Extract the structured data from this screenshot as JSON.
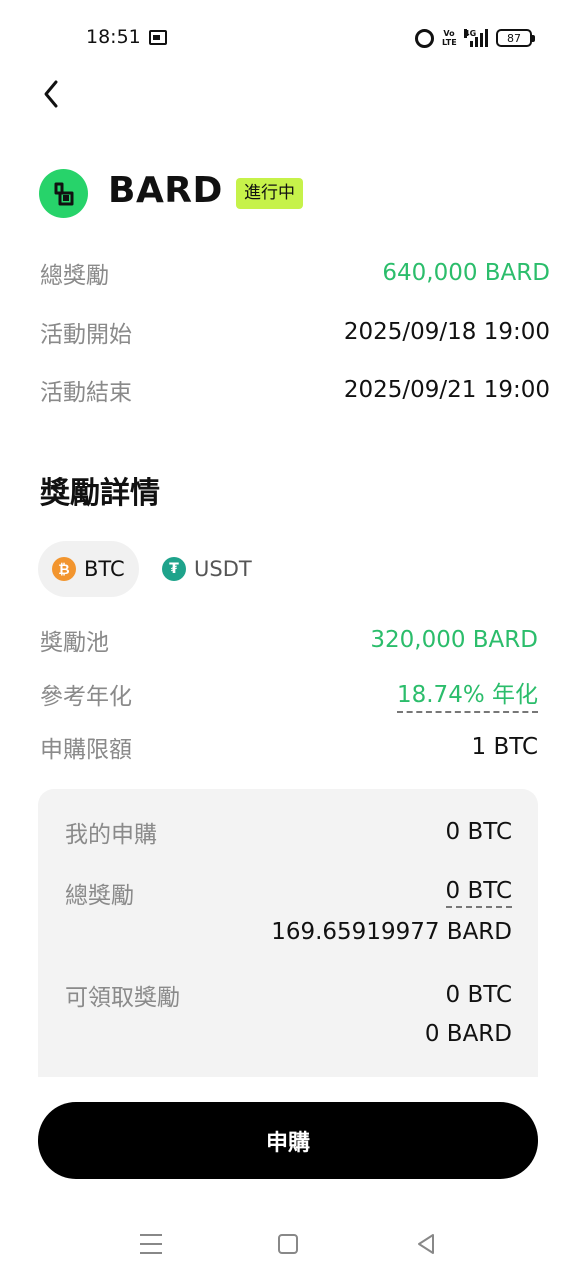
{
  "status_bar": {
    "time": "18:51",
    "volte": "Vo LTE",
    "network": "4G",
    "battery": "87"
  },
  "header": {
    "token_name": "BARD",
    "status_badge": "進行中",
    "accent_color": "#27d36a"
  },
  "overview": {
    "total_reward_label": "總獎勵",
    "total_reward_value": "640,000 BARD",
    "start_label": "活動開始",
    "start_value": "2025/09/18 19:00",
    "end_label": "活動結束",
    "end_value": "2025/09/21 19:00"
  },
  "details": {
    "title": "獎勵詳情",
    "tabs": [
      {
        "label": "BTC",
        "icon": "btc-icon",
        "active": true
      },
      {
        "label": "USDT",
        "icon": "usdt-icon",
        "active": false
      }
    ],
    "pool_label": "獎勵池",
    "pool_value": "320,000 BARD",
    "apr_label": "參考年化",
    "apr_value": "18.74% 年化",
    "limit_label": "申購限額",
    "limit_value": "1 BTC"
  },
  "summary": {
    "my_sub_label": "我的申購",
    "my_sub_value": "0 BTC",
    "total_reward_label": "總獎勵",
    "total_reward_btc": "0 BTC",
    "total_reward_bard": "169.65919977 BARD",
    "claimable_label": "可領取獎勵",
    "claimable_btc": "0 BTC",
    "claimable_bard": "0 BARD"
  },
  "actions": {
    "subscribe_label": "申購"
  }
}
